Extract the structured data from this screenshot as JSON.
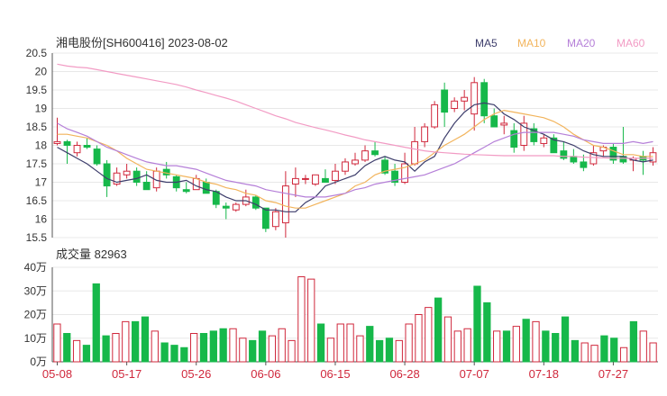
{
  "header": {
    "title": "湘电股份[SH600416] 2023-08-02"
  },
  "volume_panel": {
    "label": "成交量 82963"
  },
  "colors": {
    "up": "#d0283c",
    "down": "#16b84a",
    "ma5": "#3d3d6b",
    "ma10": "#f2b45c",
    "ma20": "#b57fd8",
    "ma60": "#f29bc4",
    "grid": "#e8e8e8",
    "axis": "#555555"
  },
  "chart_data": {
    "type": "candlestick",
    "dates": [
      "05-08",
      "05-09",
      "05-10",
      "05-11",
      "05-12",
      "05-15",
      "05-16",
      "05-17",
      "05-18",
      "05-19",
      "05-22",
      "05-23",
      "05-24",
      "05-25",
      "05-26",
      "05-29",
      "05-30",
      "05-31",
      "06-01",
      "06-02",
      "06-05",
      "06-06",
      "06-07",
      "06-08",
      "06-09",
      "06-12",
      "06-13",
      "06-14",
      "06-15",
      "06-16",
      "06-19",
      "06-20",
      "06-21",
      "06-26",
      "06-27",
      "06-28",
      "06-29",
      "06-30",
      "07-03",
      "07-04",
      "07-05",
      "07-06",
      "07-07",
      "07-10",
      "07-11",
      "07-12",
      "07-13",
      "07-14",
      "07-17",
      "07-18",
      "07-19",
      "07-20",
      "07-21",
      "07-24",
      "07-25",
      "07-26",
      "07-27",
      "07-28",
      "07-31",
      "08-01",
      "08-02"
    ],
    "x_tick_labels": [
      "05-08",
      "05-17",
      "05-26",
      "06-06",
      "06-15",
      "06-28",
      "07-07",
      "07-18",
      "07-27"
    ],
    "ohlc": [
      [
        18.05,
        18.75,
        18.0,
        18.1
      ],
      [
        18.1,
        18.15,
        17.5,
        18.0
      ],
      [
        17.8,
        18.1,
        17.7,
        18.0
      ],
      [
        18.0,
        18.2,
        17.9,
        17.95
      ],
      [
        17.9,
        18.0,
        17.45,
        17.5
      ],
      [
        17.5,
        17.6,
        16.6,
        16.9
      ],
      [
        16.95,
        17.4,
        16.9,
        17.25
      ],
      [
        17.2,
        17.5,
        17.1,
        17.3
      ],
      [
        17.3,
        17.4,
        16.9,
        17.0
      ],
      [
        17.0,
        17.3,
        16.9,
        16.8
      ],
      [
        16.85,
        17.4,
        16.75,
        17.3
      ],
      [
        17.35,
        17.55,
        17.1,
        17.2
      ],
      [
        17.15,
        17.2,
        16.75,
        16.85
      ],
      [
        16.8,
        17.0,
        16.7,
        16.75
      ],
      [
        16.8,
        17.2,
        16.8,
        17.1
      ],
      [
        17.0,
        17.1,
        16.7,
        16.7
      ],
      [
        16.75,
        16.8,
        16.3,
        16.4
      ],
      [
        16.35,
        16.45,
        16.0,
        16.3
      ],
      [
        16.25,
        16.45,
        16.2,
        16.4
      ],
      [
        16.4,
        16.8,
        16.35,
        16.6
      ],
      [
        16.6,
        16.65,
        16.25,
        16.3
      ],
      [
        16.3,
        16.3,
        15.65,
        15.75
      ],
      [
        15.8,
        16.3,
        15.7,
        16.2
      ],
      [
        15.9,
        17.3,
        15.5,
        16.9
      ],
      [
        16.95,
        17.4,
        16.6,
        17.1
      ],
      [
        17.1,
        17.2,
        16.95,
        17.1
      ],
      [
        16.95,
        17.2,
        16.9,
        17.2
      ],
      [
        17.1,
        17.35,
        17.0,
        17.0
      ],
      [
        17.05,
        17.5,
        16.95,
        17.3
      ],
      [
        17.3,
        17.65,
        17.2,
        17.55
      ],
      [
        17.5,
        17.8,
        17.45,
        17.6
      ],
      [
        17.6,
        18.0,
        17.55,
        17.85
      ],
      [
        17.85,
        18.1,
        17.7,
        17.75
      ],
      [
        17.6,
        17.7,
        17.2,
        17.25
      ],
      [
        17.3,
        17.5,
        16.9,
        17.0
      ],
      [
        17.0,
        17.8,
        16.95,
        17.5
      ],
      [
        17.5,
        18.5,
        17.45,
        18.1
      ],
      [
        18.1,
        18.6,
        17.95,
        18.5
      ],
      [
        18.5,
        19.2,
        18.45,
        19.1
      ],
      [
        19.5,
        19.7,
        18.5,
        18.9
      ],
      [
        19.0,
        19.3,
        18.9,
        19.2
      ],
      [
        19.2,
        19.5,
        18.95,
        19.3
      ],
      [
        18.85,
        19.85,
        18.4,
        19.7
      ],
      [
        19.7,
        19.8,
        18.6,
        18.8
      ],
      [
        18.8,
        19.0,
        18.5,
        18.5
      ],
      [
        18.55,
        18.8,
        18.3,
        18.6
      ],
      [
        18.4,
        18.6,
        17.8,
        17.95
      ],
      [
        18.0,
        18.8,
        17.85,
        18.6
      ],
      [
        18.45,
        18.6,
        18.0,
        18.1
      ],
      [
        18.05,
        18.3,
        17.95,
        18.2
      ],
      [
        18.2,
        18.3,
        17.8,
        17.8
      ],
      [
        17.85,
        18.1,
        17.6,
        17.65
      ],
      [
        17.7,
        17.9,
        17.5,
        17.55
      ],
      [
        17.55,
        17.75,
        17.3,
        17.4
      ],
      [
        17.5,
        18.0,
        17.45,
        17.8
      ],
      [
        17.85,
        18.0,
        17.7,
        17.95
      ],
      [
        17.95,
        18.05,
        17.5,
        17.6
      ],
      [
        17.7,
        18.5,
        17.5,
        17.55
      ],
      [
        17.6,
        17.7,
        17.3,
        17.65
      ],
      [
        17.7,
        17.85,
        17.2,
        17.6
      ],
      [
        17.55,
        17.95,
        17.45,
        17.8
      ]
    ],
    "volume": [
      16,
      12,
      9,
      7,
      33,
      11,
      12,
      17,
      17,
      19,
      13,
      8,
      7,
      6,
      12,
      12,
      13,
      14,
      14,
      10,
      9,
      13,
      11,
      14,
      9,
      36,
      35,
      16,
      10,
      16,
      16,
      11,
      15,
      9,
      10,
      9,
      16,
      20,
      23,
      27,
      19,
      13,
      14,
      32,
      25,
      13,
      13,
      15,
      18,
      17,
      13,
      12,
      19,
      9,
      8,
      7,
      11,
      10,
      6,
      17,
      13,
      8
    ],
    "ma": {
      "MA5": [
        17.95,
        17.8,
        17.65,
        17.5,
        17.3,
        17.1,
        17.0,
        17.05,
        17.1,
        17.2,
        17.05,
        17.0,
        17.0,
        17.05,
        16.9,
        16.8,
        16.75,
        16.6,
        16.5,
        16.5,
        16.4,
        16.25,
        16.25,
        16.2,
        16.2,
        16.45,
        16.6,
        16.9,
        17.0,
        17.1,
        17.2,
        17.45,
        17.6,
        17.7,
        17.6,
        17.55,
        17.3,
        17.55,
        17.7,
        18.2,
        18.6,
        18.9,
        19.1,
        19.15,
        19.1,
        18.85,
        18.7,
        18.5,
        18.4,
        18.3,
        18.15,
        18.1,
        18.0,
        17.85,
        17.75,
        17.7,
        17.7,
        17.7,
        17.6,
        17.55,
        17.6
      ],
      "MA10": [
        18.3,
        18.3,
        18.25,
        18.2,
        18.1,
        18.0,
        17.85,
        17.65,
        17.5,
        17.35,
        17.3,
        17.25,
        17.2,
        17.15,
        17.1,
        17.0,
        16.95,
        16.85,
        16.8,
        16.7,
        16.65,
        16.5,
        16.45,
        16.35,
        16.3,
        16.3,
        16.4,
        16.5,
        16.6,
        16.7,
        16.9,
        17.0,
        17.2,
        17.3,
        17.35,
        17.4,
        17.5,
        17.6,
        17.8,
        18.0,
        18.15,
        18.3,
        18.5,
        18.7,
        18.85,
        18.95,
        18.9,
        18.85,
        18.8,
        18.75,
        18.65,
        18.5,
        18.3,
        18.15,
        18.0,
        17.95,
        17.85,
        17.75,
        17.75,
        17.7,
        17.7
      ],
      "MA20": [
        18.6,
        18.45,
        18.35,
        18.25,
        18.1,
        17.95,
        17.85,
        17.75,
        17.65,
        17.55,
        17.5,
        17.45,
        17.45,
        17.4,
        17.35,
        17.25,
        17.15,
        17.05,
        17.0,
        16.95,
        16.9,
        16.8,
        16.75,
        16.7,
        16.65,
        16.6,
        16.6,
        16.6,
        16.65,
        16.7,
        16.8,
        16.85,
        16.95,
        17.0,
        17.05,
        17.1,
        17.15,
        17.2,
        17.3,
        17.4,
        17.5,
        17.65,
        17.8,
        17.95,
        18.1,
        18.2,
        18.3,
        18.35,
        18.35,
        18.35,
        18.35,
        18.3,
        18.25,
        18.15,
        18.1,
        18.05,
        18.05,
        18.05,
        18.1,
        18.05,
        18.1
      ],
      "MA60": [
        20.2,
        20.15,
        20.12,
        20.1,
        20.05,
        20.0,
        19.95,
        19.9,
        19.85,
        19.8,
        19.75,
        19.7,
        19.65,
        19.58,
        19.5,
        19.43,
        19.35,
        19.28,
        19.2,
        19.1,
        19.0,
        18.9,
        18.8,
        18.72,
        18.62,
        18.55,
        18.48,
        18.42,
        18.35,
        18.28,
        18.22,
        18.15,
        18.1,
        18.05,
        18.0,
        17.95,
        17.9,
        17.85,
        17.82,
        17.8,
        17.78,
        17.76,
        17.75,
        17.74,
        17.73,
        17.72,
        17.72,
        17.72,
        17.72,
        17.72,
        17.72,
        17.7,
        17.7,
        17.68,
        17.67,
        17.66,
        17.65,
        17.65,
        17.65,
        17.65,
        17.65
      ]
    },
    "legend": [
      "MA5",
      "MA10",
      "MA20",
      "MA60"
    ],
    "price_axis": {
      "ticks": [
        "20.5",
        "20",
        "19.5",
        "19",
        "18.5",
        "18",
        "17.5",
        "17",
        "16.5",
        "16",
        "15.5"
      ],
      "ylim": [
        15.5,
        20.5
      ]
    },
    "volume_axis": {
      "ticks": [
        "40万",
        "30万",
        "20万",
        "10万",
        "0万"
      ],
      "ylim": [
        0,
        40
      ]
    }
  }
}
